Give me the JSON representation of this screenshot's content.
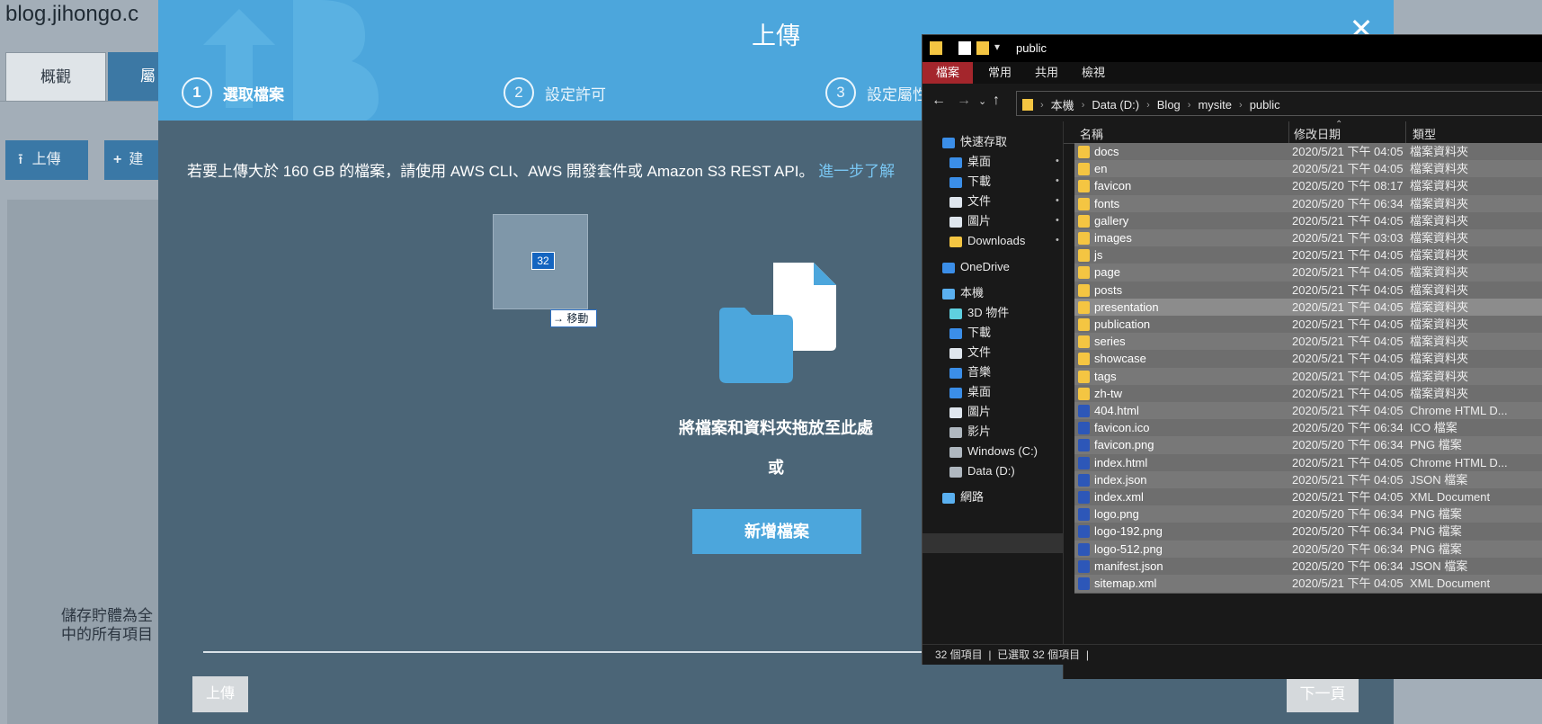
{
  "background": {
    "title": "blog.jihongo.c",
    "tab_overview": "概觀",
    "tab_properties": "屬",
    "upload_label": "上傳",
    "create_label": "建",
    "note": "儲存貯體為全\n中的所有項目"
  },
  "modal": {
    "title": "上傳",
    "close_icon": "close-icon",
    "steps": [
      {
        "num": "1",
        "label": "選取檔案"
      },
      {
        "num": "2",
        "label": "設定許可"
      },
      {
        "num": "3",
        "label": "設定屬性"
      }
    ],
    "info_text": "若要上傳大於 160 GB 的檔案，請使用 AWS CLI、AWS 開發套件或 Amazon S3 REST API。",
    "learn_more": "進一步了解",
    "drag_count": "32",
    "move_badge": "→ 移動",
    "drop_text": "將檔案和資料夾拖放至此處",
    "or_text": "或",
    "add_files": "新增檔案",
    "upload_button": "上傳",
    "next_button": "下一頁"
  },
  "explorer": {
    "window_title": "public",
    "ribbon_tabs": [
      "檔案",
      "常用",
      "共用",
      "檢視"
    ],
    "breadcrumbs": [
      "本機",
      "Data (D:)",
      "Blog",
      "mysite",
      "public"
    ],
    "nav_items": [
      {
        "label": "快速存取",
        "icon": "star-icon",
        "pinned": false
      },
      {
        "label": "桌面",
        "icon": "desktop-icon",
        "pinned": true
      },
      {
        "label": "下載",
        "icon": "download-icon",
        "pinned": true
      },
      {
        "label": "文件",
        "icon": "document-icon",
        "pinned": true
      },
      {
        "label": "圖片",
        "icon": "picture-icon",
        "pinned": true
      },
      {
        "label": "Downloads",
        "icon": "folder-icon",
        "pinned": true
      },
      {
        "label": "OneDrive",
        "icon": "cloud-icon",
        "pinned": false
      },
      {
        "label": "本機",
        "icon": "computer-icon",
        "pinned": false
      },
      {
        "label": "3D 物件",
        "icon": "cube-icon",
        "pinned": false
      },
      {
        "label": "下載",
        "icon": "download-icon",
        "pinned": false
      },
      {
        "label": "文件",
        "icon": "document-icon",
        "pinned": false
      },
      {
        "label": "音樂",
        "icon": "music-icon",
        "pinned": false
      },
      {
        "label": "桌面",
        "icon": "desktop-icon",
        "pinned": false
      },
      {
        "label": "圖片",
        "icon": "picture-icon",
        "pinned": false
      },
      {
        "label": "影片",
        "icon": "video-icon",
        "pinned": false
      },
      {
        "label": "Windows (C:)",
        "icon": "drive-icon",
        "pinned": false
      },
      {
        "label": "Data (D:)",
        "icon": "drive-icon",
        "pinned": false
      },
      {
        "label": "網路",
        "icon": "network-icon",
        "pinned": false
      }
    ],
    "columns": {
      "name": "名稱",
      "date": "修改日期",
      "type": "類型"
    },
    "files": [
      {
        "name": "docs",
        "date": "2020/5/21 下午 04:05",
        "type": "檔案資料夾"
      },
      {
        "name": "en",
        "date": "2020/5/21 下午 04:05",
        "type": "檔案資料夾"
      },
      {
        "name": "favicon",
        "date": "2020/5/20 下午 08:17",
        "type": "檔案資料夾"
      },
      {
        "name": "fonts",
        "date": "2020/5/20 下午 06:34",
        "type": "檔案資料夾"
      },
      {
        "name": "gallery",
        "date": "2020/5/21 下午 04:05",
        "type": "檔案資料夾"
      },
      {
        "name": "images",
        "date": "2020/5/21 下午 03:03",
        "type": "檔案資料夾"
      },
      {
        "name": "js",
        "date": "2020/5/21 下午 04:05",
        "type": "檔案資料夾"
      },
      {
        "name": "page",
        "date": "2020/5/21 下午 04:05",
        "type": "檔案資料夾"
      },
      {
        "name": "posts",
        "date": "2020/5/21 下午 04:05",
        "type": "檔案資料夾"
      },
      {
        "name": "presentation",
        "date": "2020/5/21 下午 04:05",
        "type": "檔案資料夾"
      },
      {
        "name": "publication",
        "date": "2020/5/21 下午 04:05",
        "type": "檔案資料夾"
      },
      {
        "name": "series",
        "date": "2020/5/21 下午 04:05",
        "type": "檔案資料夾"
      },
      {
        "name": "showcase",
        "date": "2020/5/21 下午 04:05",
        "type": "檔案資料夾"
      },
      {
        "name": "tags",
        "date": "2020/5/21 下午 04:05",
        "type": "檔案資料夾"
      },
      {
        "name": "zh-tw",
        "date": "2020/5/21 下午 04:05",
        "type": "檔案資料夾"
      },
      {
        "name": "404.html",
        "date": "2020/5/21 下午 04:05",
        "type": "Chrome HTML D..."
      },
      {
        "name": "favicon.ico",
        "date": "2020/5/20 下午 06:34",
        "type": "ICO 檔案"
      },
      {
        "name": "favicon.png",
        "date": "2020/5/20 下午 06:34",
        "type": "PNG 檔案"
      },
      {
        "name": "index.html",
        "date": "2020/5/21 下午 04:05",
        "type": "Chrome HTML D..."
      },
      {
        "name": "index.json",
        "date": "2020/5/21 下午 04:05",
        "type": "JSON 檔案"
      },
      {
        "name": "index.xml",
        "date": "2020/5/21 下午 04:05",
        "type": "XML Document"
      },
      {
        "name": "logo.png",
        "date": "2020/5/20 下午 06:34",
        "type": "PNG 檔案"
      },
      {
        "name": "logo-192.png",
        "date": "2020/5/20 下午 06:34",
        "type": "PNG 檔案"
      },
      {
        "name": "logo-512.png",
        "date": "2020/5/20 下午 06:34",
        "type": "PNG 檔案"
      },
      {
        "name": "manifest.json",
        "date": "2020/5/20 下午 06:34",
        "type": "JSON 檔案"
      },
      {
        "name": "sitemap.xml",
        "date": "2020/5/21 下午 04:05",
        "type": "XML Document"
      }
    ],
    "status_items": "32 個項目",
    "status_selected": "已選取 32 個項目",
    "colors": {
      "folder": "#f4c542",
      "unknown_file": "#2d57b8",
      "accent": "#a4262c"
    }
  }
}
